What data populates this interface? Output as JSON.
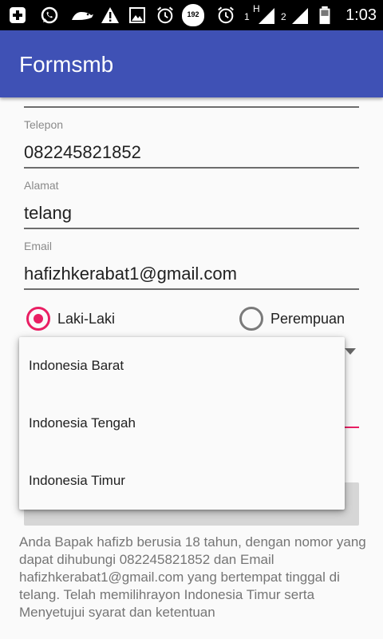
{
  "status_bar": {
    "time": "1:03",
    "badge_number": "192",
    "sim1_label": "1",
    "sim1_network": "H",
    "sim2_label": "2",
    "icons": [
      "add-box-icon",
      "whatsapp-icon",
      "bird-icon",
      "warning-icon",
      "image-icon",
      "alarm-icon",
      "speed-limit-icon",
      "alarm-icon",
      "signal-icon",
      "signal-icon",
      "battery-icon"
    ]
  },
  "app_bar": {
    "title": "Formsmb"
  },
  "form": {
    "name_value_partial": "hafizb",
    "phone_label": "Telepon",
    "phone_value": "082245821852",
    "address_label": "Alamat",
    "address_value": "telang",
    "email_label": "Email",
    "email_value": "hafizhkerabat1@gmail.com",
    "gender_options": [
      {
        "label": "Laki-Laki",
        "selected": true
      },
      {
        "label": "Perempuan",
        "selected": false
      }
    ]
  },
  "dropdown": {
    "items": [
      "Indonesia Barat",
      "Indonesia Tengah",
      "Indonesia Timur"
    ]
  },
  "summary_text": "Anda Bapak hafizb berusia 18 tahun, dengan nomor yang dapat dihubungi 082245821852 dan Email hafizhkerabat1@gmail.com yang bertempat tinggal di telang. Telah memilihrayon Indonesia Timur serta Menyetujui syarat dan ketentuan",
  "colors": {
    "app_bar": "#3f51b5",
    "accent": "#e91e63",
    "status_bar": "#000000"
  }
}
